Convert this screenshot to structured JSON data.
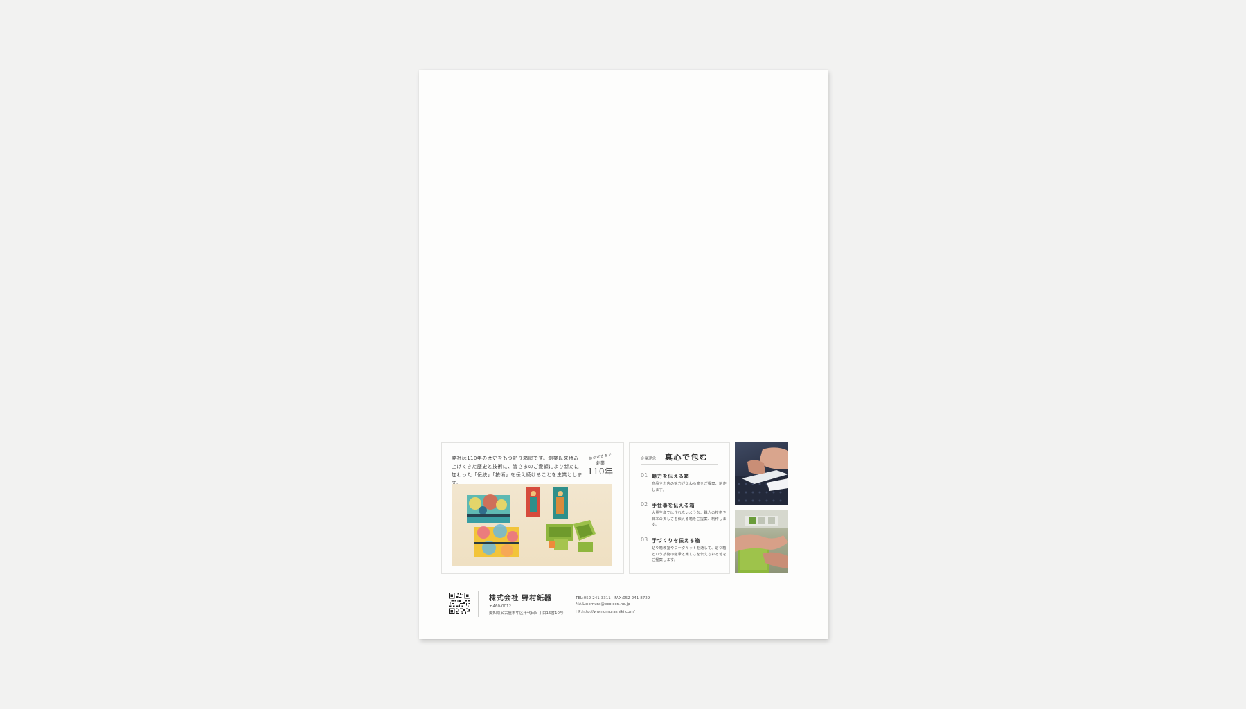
{
  "brochure": {
    "intro_text": "弊社は110年の歴史をもつ貼り箱屋です。創業以来積み上げてきた歴史と技術に、皆さまのご愛顧により新たに加わった「伝統」「技術」を伝え続けることを生業とします。",
    "anniversary": {
      "thanks": "おかげさまで",
      "label": "創業",
      "years": "110年"
    },
    "concept": {
      "label": "企業理念",
      "title": "真心で包む",
      "points": [
        {
          "number": "01",
          "title": "魅力を伝える箱",
          "description": "商品やお店の魅力が伝わる箱をご提案、制作します。"
        },
        {
          "number": "02",
          "title": "手仕事を伝える箱",
          "description": "大量生産では作れないような、職人の技術や日本の美しさを伝える箱をご提案、制作します。"
        },
        {
          "number": "03",
          "title": "手づくりを伝える箱",
          "description": "貼り箱教室やワークキットを通して、貼り箱という技術の継承と楽しさを伝えられる箱をご提案します。"
        }
      ]
    },
    "company": {
      "name": "株式会社 野村紙器",
      "postal": "〒460-0012",
      "address": "愛知県名古屋市中区千代田５丁目15番10号",
      "tel_fax": "TEL:052-241-3311　FAX:052-241-8729",
      "mail": "MAIL:nomura@eco.ocn.ne.jp",
      "hp": "HP:http://ww.nomurashiki.com/"
    },
    "colors": {
      "background": "#f2f2f1",
      "paper": "#fdfdfc",
      "text": "#333333"
    }
  }
}
